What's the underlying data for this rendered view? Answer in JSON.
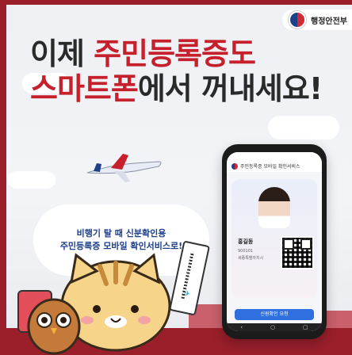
{
  "header": {
    "ministry_name": "행정안전부"
  },
  "headline": {
    "line1_prefix": "이제 ",
    "line1_highlight": "주민등록증도",
    "line2_highlight": "스마트폰",
    "line2_suffix": "에서 꺼내세요!"
  },
  "bubble": {
    "line1": "비행기 탈 때 신분확인용",
    "line2": "주민등록증 모바일 확인서비스로!"
  },
  "phone": {
    "app_header": "주민등록증 모바일 확인서비스",
    "holder_name": "홍길동",
    "id_line1": "900101",
    "id_line2": "세종특별자치시",
    "verify_button": "신원확인 요청"
  },
  "icons": [
    "gov-logo-icon",
    "plane-icon",
    "qr-code-icon"
  ]
}
